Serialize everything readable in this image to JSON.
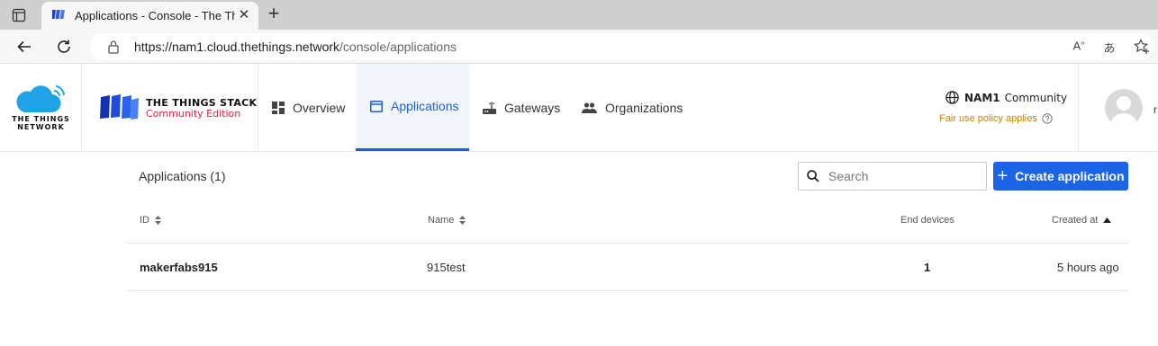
{
  "browser": {
    "tab_title": "Applications - Console - The Things Stack",
    "close_glyph": "✕",
    "new_tab_glyph": "+",
    "url_host": "https://nam1.cloud.thethings.network",
    "url_path": "/console/applications",
    "read_aloud_glyph": "A",
    "translate_glyph": "あ"
  },
  "header": {
    "ttn_logo_text_line1": "THE THINGS",
    "ttn_logo_text_line2": "NETWORK",
    "stack_title": "THE THINGS STACK",
    "stack_edition": "Community Edition",
    "nav": [
      {
        "label": "Overview",
        "icon": "dashboard-icon"
      },
      {
        "label": "Applications",
        "icon": "window-icon"
      },
      {
        "label": "Gateways",
        "icon": "router-icon"
      },
      {
        "label": "Organizations",
        "icon": "people-icon"
      }
    ],
    "cluster_name": "NAM1",
    "cluster_label": "Community",
    "fair_use": "Fair use policy applies",
    "user_name_clip": "r"
  },
  "main": {
    "title": "Applications (1)",
    "search_placeholder": "Search",
    "create_label": "Create application",
    "columns": {
      "id": "ID",
      "name": "Name",
      "end_devices": "End devices",
      "created_at": "Created at"
    },
    "rows": [
      {
        "id": "makerfabs915",
        "name": "915test",
        "end_devices": "1",
        "created_at": "5 hours ago"
      }
    ]
  },
  "colors": {
    "accent": "#1c64e6",
    "nav_active": "#1c5fd8",
    "brand_red": "#e3213b",
    "warning": "#c4840a"
  }
}
